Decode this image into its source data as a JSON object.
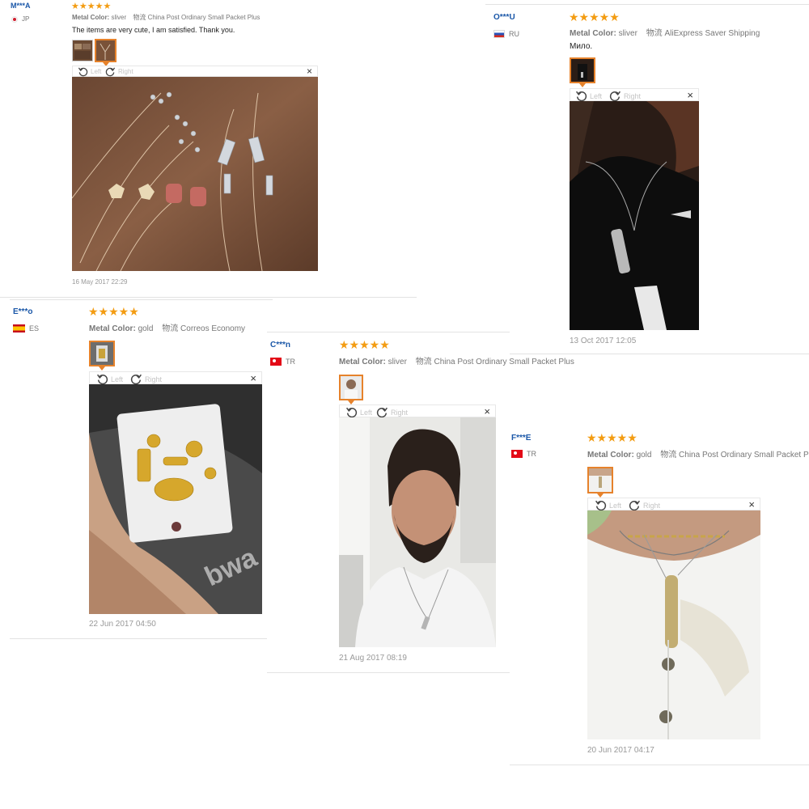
{
  "reviews": [
    {
      "user": "M***A",
      "country": "JP",
      "metal_label": "Metal Color:",
      "metal_value": "sliver",
      "shipping_label": "物流",
      "shipping_value": "China Post Ordinary Small Packet Plus",
      "text": "The items are very cute, I am satisfied. Thank you.",
      "viewer": {
        "left": "Left",
        "right": "Right",
        "close": "×"
      },
      "date": "16 May 2017 22:29"
    },
    {
      "user": "O***U",
      "country": "RU",
      "metal_label": "Metal Color:",
      "metal_value": "sliver",
      "shipping_label": "物流",
      "shipping_value": "AliExpress Saver Shipping",
      "text": "Мило.",
      "viewer": {
        "left": "Left",
        "right": "Right",
        "close": "×"
      },
      "date": "13 Oct 2017 12:05"
    },
    {
      "user": "E***o",
      "country": "ES",
      "metal_label": "Metal Color:",
      "metal_value": "gold",
      "shipping_label": "物流",
      "shipping_value": "Correos Economy",
      "viewer": {
        "left": "Left",
        "right": "Right",
        "close": "×"
      },
      "date": "22 Jun 2017 04:50"
    },
    {
      "user": "C***n",
      "country": "TR",
      "metal_label": "Metal Color:",
      "metal_value": "sliver",
      "shipping_label": "物流",
      "shipping_value": "China Post Ordinary Small Packet Plus",
      "viewer": {
        "left": "Left",
        "right": "Right",
        "close": "×"
      },
      "date": "21 Aug 2017 08:19"
    },
    {
      "user": "F***E",
      "country": "TR",
      "metal_label": "Metal Color:",
      "metal_value": "gold",
      "shipping_label": "物流",
      "shipping_value": "China Post Ordinary Small Packet Pl",
      "viewer": {
        "left": "Left",
        "right": "Right",
        "close": "×"
      },
      "date": "20 Jun 2017 04:17"
    }
  ],
  "stars": "★★★★★",
  "colors": {
    "user_link": "#1a57a8",
    "star": "#f39c12",
    "thumb_active_border": "#e6822b"
  },
  "icons": [
    "rotate-left-icon",
    "rotate-right-icon",
    "close-icon",
    "star-icon",
    "flag-icon"
  ]
}
